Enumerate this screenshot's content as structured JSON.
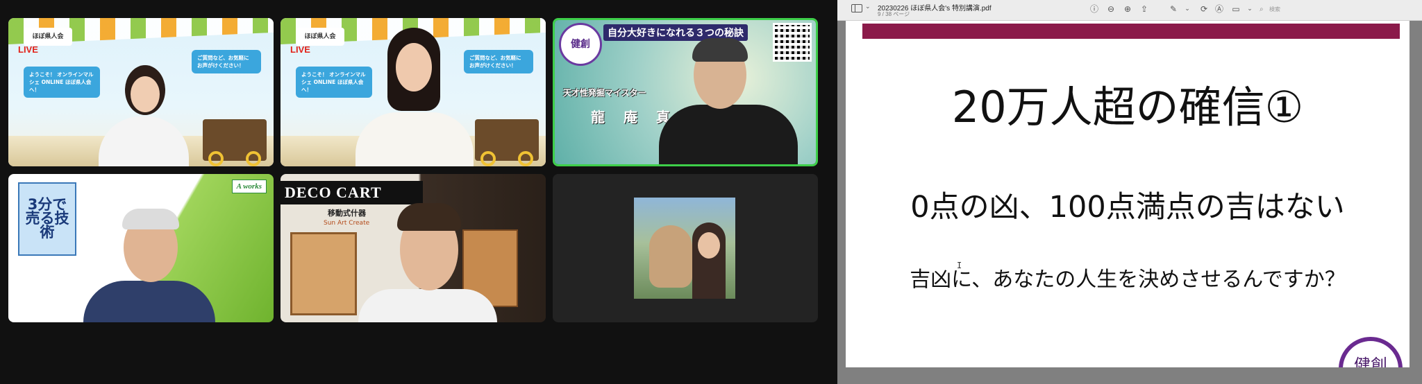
{
  "meeting": {
    "tiles": [
      {
        "live": "LIVE",
        "logo": "ほぼ県人会",
        "bubble_left": "ようこそ！ オンラインマルシェ ONLINE ほぼ県人会へ！",
        "bubble_right": "ご質問など、お気軽に お声がけください！"
      },
      {
        "live": "LIVE",
        "logo": "ほぼ県人会",
        "bubble_left": "ようこそ！ オンラインマルシェ ONLINE ほぼ県人会へ！",
        "bubble_right": "ご質問など、お気軽に お声がけください！"
      },
      {
        "emblem": "健創",
        "title": "自分大好きになれる３つの秘訣",
        "role": "天才性発掘マイスター",
        "name": "龍 庵 真"
      },
      {
        "book_title": "3分で 売る技術",
        "brand": "A works"
      },
      {
        "banner": "DECO CART",
        "sub": "移動式什器",
        "brand": "Sun Art Create"
      },
      {}
    ]
  },
  "pdf": {
    "title": "20230226 ほぼ県人会's 特別講演.pdf",
    "pages": "9 / 38 ページ",
    "search_placeholder": "検索",
    "slide": {
      "title": "20万人超の確信①",
      "line1": "0点の凶、100点満点の吉はない",
      "line2": "吉凶に、あなたの人生を決めさせるんですか？",
      "logo": "健創"
    }
  },
  "colors": {
    "active_speaker_border": "#3ecf4a",
    "slide_band": "#8b1a4a"
  }
}
